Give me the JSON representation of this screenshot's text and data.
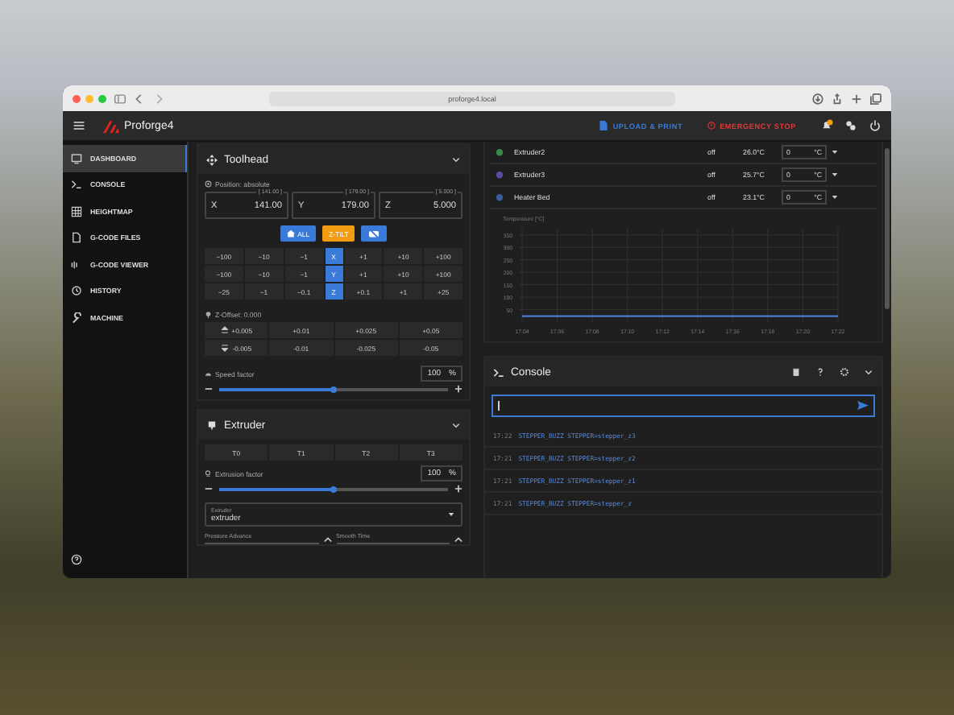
{
  "browser": {
    "url": "proforge4.local"
  },
  "app_bar": {
    "title": "Proforge4",
    "upload": "UPLOAD & PRINT",
    "estop": "EMERGENCY STOP"
  },
  "sidebar": {
    "items": [
      {
        "label": "DASHBOARD",
        "selected": true
      },
      {
        "label": "CONSOLE",
        "selected": false
      },
      {
        "label": "HEIGHTMAP",
        "selected": false
      },
      {
        "label": "G-CODE FILES",
        "selected": false
      },
      {
        "label": "G-CODE VIEWER",
        "selected": false
      },
      {
        "label": "HISTORY",
        "selected": false
      },
      {
        "label": "MACHINE",
        "selected": false
      }
    ]
  },
  "toolhead": {
    "title": "Toolhead",
    "position": "Position: absolute",
    "axes": [
      {
        "label": "X",
        "target": "[ 141.00 ]",
        "value": "141.00"
      },
      {
        "label": "Y",
        "target": "[ 179.00 ]",
        "value": "179.00"
      },
      {
        "label": "Z",
        "target": "[ 5.000 ]",
        "value": "5.000"
      }
    ],
    "home_buttons": [
      {
        "label": "ALL",
        "kind": "home"
      },
      {
        "label": "Z-TILT",
        "kind": "tilt"
      },
      {
        "kind": "motors-off"
      }
    ],
    "jog_rows": [
      {
        "axis": "X",
        "minus": [
          "−100",
          "−10",
          "−1"
        ],
        "plus": [
          "+1",
          "+10",
          "+100"
        ]
      },
      {
        "axis": "Y",
        "minus": [
          "−100",
          "−10",
          "−1"
        ],
        "plus": [
          "+1",
          "+10",
          "+100"
        ]
      },
      {
        "axis": "Z",
        "minus": [
          "−25",
          "−1",
          "−0.1"
        ],
        "plus": [
          "+0.1",
          "+1",
          "+25"
        ]
      }
    ],
    "z_offset": "Z-Offset: 0.000",
    "z_up": [
      "+0.005",
      "+0.01",
      "+0.025",
      "+0.05"
    ],
    "z_down": [
      "-0.005",
      "-0.01",
      "-0.025",
      "-0.05"
    ],
    "speed": {
      "label": "Speed factor",
      "value": "100",
      "unit": "%",
      "level": 0.5
    }
  },
  "extruder": {
    "title": "Extruder",
    "tools": [
      {
        "label": "T0",
        "selected": false
      },
      {
        "label": "T1",
        "selected": false
      },
      {
        "label": "T2",
        "selected": false
      },
      {
        "label": "T3",
        "selected": false
      }
    ],
    "factor": {
      "label": "Extrusion factor",
      "value": "100",
      "unit": "%",
      "level": 0.5
    },
    "select": {
      "label": "Extruder",
      "value": "extruder"
    },
    "fields": [
      "Pressure Advance",
      "Smooth Time"
    ]
  },
  "heaters": [
    {
      "name": "Extruder2",
      "state": "off",
      "temp": "26.0°C",
      "target": "0",
      "unit": "°C",
      "color": "#3a8a4a"
    },
    {
      "name": "Extruder3",
      "state": "off",
      "temp": "25.7°C",
      "target": "0",
      "unit": "°C",
      "color": "#5a4aa0"
    },
    {
      "name": "Heater Bed",
      "state": "off",
      "temp": "23.1°C",
      "target": "0",
      "unit": "°C",
      "color": "#3a5a9a"
    }
  ],
  "temperature_chart": {
    "label": "Temperature [°C]",
    "chart_data": {
      "type": "line",
      "categories": [
        "17:04",
        "17:06",
        "17:08",
        "17:10",
        "17:12",
        "17:14",
        "17:16",
        "17:18",
        "17:20",
        "17:22"
      ],
      "ylim": [
        0,
        375
      ],
      "yticks": [
        50,
        100,
        150,
        200,
        250,
        300,
        350
      ],
      "grid": true,
      "series": [
        {
          "color": "#4a7ad0",
          "values": [
            24,
            24,
            24,
            24,
            24,
            24,
            24,
            24,
            24,
            24
          ]
        }
      ]
    }
  },
  "console": {
    "title": "Console",
    "entries": [
      {
        "time": "17:22",
        "text": "STEPPER_BUZZ STEPPER=stepper_z3"
      },
      {
        "time": "17:21",
        "text": "STEPPER_BUZZ STEPPER=stepper_z2"
      },
      {
        "time": "17:21",
        "text": "STEPPER_BUZZ STEPPER=stepper_z1"
      },
      {
        "time": "17:21",
        "text": "STEPPER_BUZZ STEPPER=stepper_z"
      }
    ]
  }
}
